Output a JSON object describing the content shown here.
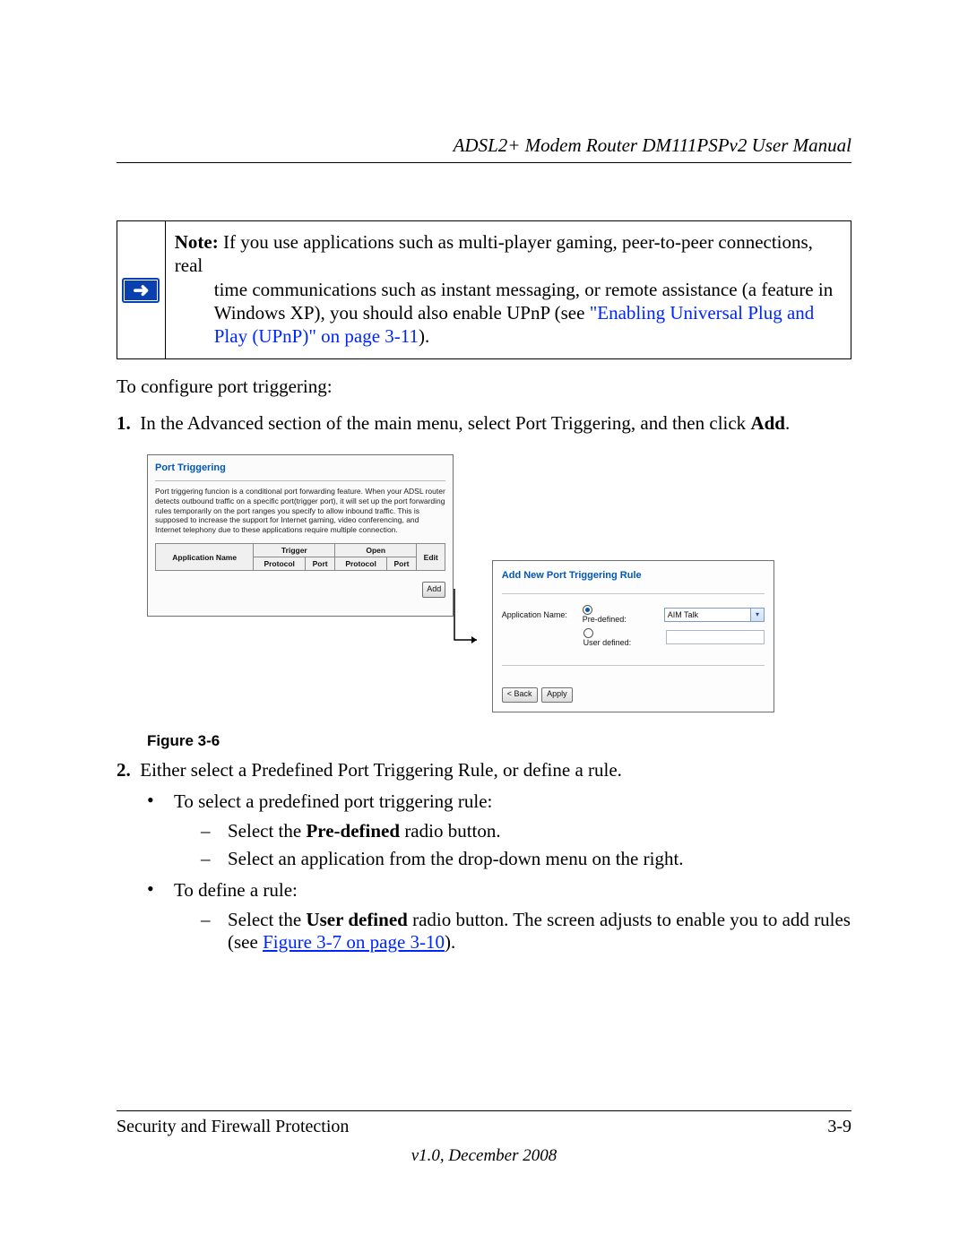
{
  "header": {
    "title": "ADSL2+ Modem Router DM111PSPv2 User Manual"
  },
  "note": {
    "label": "Note:",
    "text_before_indent": " If you use applications such as multi-player gaming, peer-to-peer connections, real ",
    "line2": "time communications such as instant messaging, or remote assistance (a feature in ",
    "line3_prefix": "Windows XP), you should also enable UPnP (see ",
    "link_text": "\"Enabling Universal Plug and Play (UPnP)\" on page 3-11",
    "line3_suffix": ")."
  },
  "para_intro": "To configure port triggering:",
  "steps": {
    "s1_num": "1.",
    "s1_text_a": "In the Advanced section of the main menu, select Port Triggering, and then click ",
    "s1_bold": "Add",
    "s1_text_b": ".",
    "s2_num": "2.",
    "s2_text": "Either select a Predefined Port Triggering Rule, or define a rule."
  },
  "bullets": {
    "b1": "To select a predefined port triggering rule:",
    "d1a_pre": "Select the ",
    "d1a_bold": "Pre-defined",
    "d1a_post": " radio button.",
    "d1b": "Select an application from the drop-down menu on the right.",
    "b2": "To define a rule:",
    "d2a_pre": "Select the ",
    "d2a_bold": "User defined",
    "d2a_post": " radio button. The screen adjusts to enable you to add rules (see ",
    "d2a_link": "Figure 3-7 on page 3-10",
    "d2a_end": ")."
  },
  "figure": {
    "caption": "Figure 3-6",
    "panelA": {
      "title": "Port Triggering",
      "desc": "Port triggering funcion is a conditional port forwarding feature. When your ADSL router detects outbound traffic on a specific port(trigger port), it will set up the port forwarding rules temporarily on the port ranges you specify to allow inbound traffic. This is supposed to increase the support for Internet gaming, video conferencing, and Internet telephony due to these applications require multiple connection.",
      "th_app": "Application Name",
      "th_trigger": "Trigger",
      "th_open": "Open",
      "th_edit": "Edit",
      "th_protocol": "Protocol",
      "th_port": "Port",
      "add_btn": "Add"
    },
    "panelB": {
      "title": "Add New Port Triggering Rule",
      "app_name_lbl": "Application Name:",
      "predef_lbl": "Pre-defined:",
      "userdef_lbl": "User defined:",
      "select_value": "AIM Talk",
      "back_btn": "< Back",
      "apply_btn": "Apply"
    }
  },
  "footer": {
    "left": "Security and Firewall Protection",
    "right": "3-9",
    "version": "v1.0, December 2008"
  }
}
